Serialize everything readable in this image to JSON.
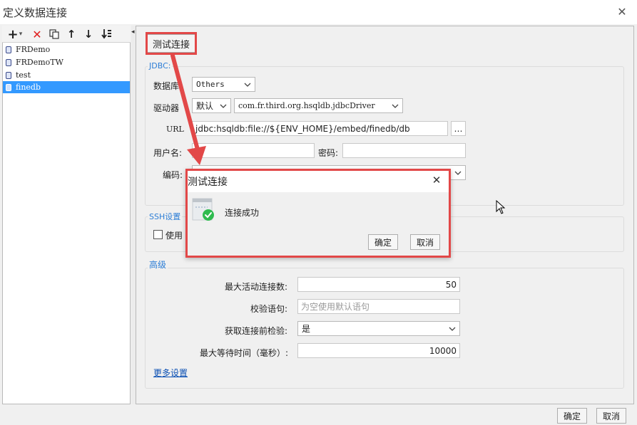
{
  "window": {
    "title": "定义数据连接",
    "close_glyph": "✕"
  },
  "toolbar": {
    "add_glyph": "+",
    "add_dropdown_glyph": "▾",
    "delete_glyph": "✕",
    "up_glyph": "↑",
    "down_glyph": "↓"
  },
  "connections": [
    {
      "label": "FRDemo",
      "selected": false
    },
    {
      "label": "FRDemoTW",
      "selected": false
    },
    {
      "label": "test",
      "selected": false
    },
    {
      "label": "finedb",
      "selected": true
    }
  ],
  "splitter": {
    "arrow_glyph": "◂"
  },
  "test_connection_button": "测试连接",
  "jdbc": {
    "group_title": "JDBC:",
    "db_label": "数据库",
    "db_value": "Others",
    "driver_label": "驱动器",
    "driver_mode": "默认",
    "driver_value": "com.fr.third.org.hsqldb.jdbcDriver",
    "url_label": "URL",
    "url_value": "jdbc:hsqldb:file://${ENV_HOME}/embed/finedb/db",
    "url_more": "…",
    "username_label": "用户名:",
    "username_value": "a",
    "password_label": "密码:",
    "password_value": "",
    "encoding_label": "编码:"
  },
  "ssh": {
    "group_title": "SSH设置",
    "use_label": "使用"
  },
  "advanced": {
    "group_title": "高级",
    "max_active_label": "最大活动连接数:",
    "max_active_value": "50",
    "validation_label": "校验语句:",
    "validation_placeholder": "为空使用默认语句",
    "test_before_label": "获取连接前检验:",
    "test_before_value": "是",
    "max_wait_label": "最大等待时间（毫秒）:",
    "max_wait_value": "10000",
    "more_settings": "更多设置"
  },
  "dialog": {
    "title": "测试连接",
    "close_glyph": "✕",
    "message": "连接成功",
    "ok": "确定",
    "cancel": "取消"
  },
  "footer": {
    "ok": "确定",
    "cancel": "取消"
  },
  "colors": {
    "accent_blue": "#2d7ed6",
    "selection": "#3399ff",
    "annotation_red": "#e24848",
    "success_green": "#2fbb4f"
  }
}
